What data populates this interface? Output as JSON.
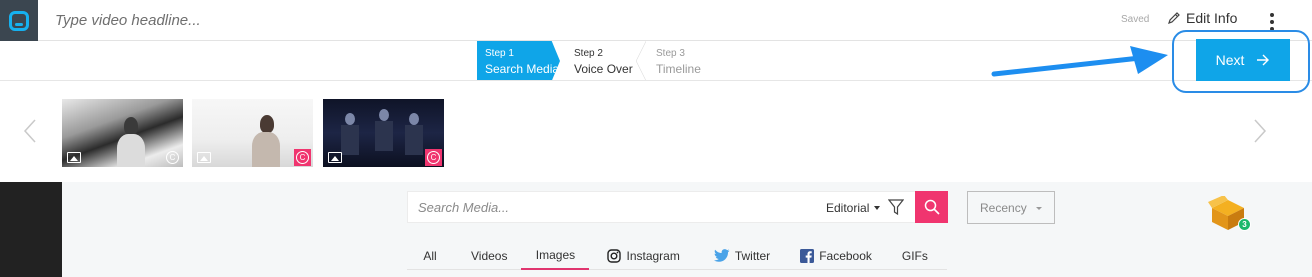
{
  "header": {
    "headline_placeholder": "Type video headline...",
    "saved_label": "Saved",
    "edit_info_label": "Edit Info"
  },
  "steps": [
    {
      "num": "Step 1",
      "label": "Search Media",
      "state": "active"
    },
    {
      "num": "Step 2",
      "label": "Voice Over",
      "state": "next"
    },
    {
      "num": "Step 3",
      "label": "Timeline",
      "state": "upcoming"
    }
  ],
  "next_button": {
    "label": "Next"
  },
  "carousel": {
    "thumbnails": [
      {
        "name": "thumbnail-1",
        "type": "image",
        "license": "copyright"
      },
      {
        "name": "thumbnail-2",
        "type": "image",
        "license": "copyright-selected"
      },
      {
        "name": "thumbnail-3",
        "type": "image",
        "license": "copyright-selected"
      }
    ]
  },
  "search": {
    "placeholder": "Search Media...",
    "source_selected": "Editorial",
    "sort_selected": "Recency"
  },
  "box_badge": "3",
  "tabs": [
    {
      "label": "All"
    },
    {
      "label": "Videos"
    },
    {
      "label": "Images",
      "active": true
    },
    {
      "label": "Instagram",
      "icon": "instagram-icon"
    },
    {
      "label": "Twitter",
      "icon": "twitter-icon"
    },
    {
      "label": "Facebook",
      "icon": "facebook-icon"
    },
    {
      "label": "GIFs"
    }
  ],
  "colors": {
    "accent_blue": "#0fa5e8",
    "accent_pink": "#f0356f",
    "logo_bg": "#3b4650",
    "badge_green": "#1bb86b"
  }
}
